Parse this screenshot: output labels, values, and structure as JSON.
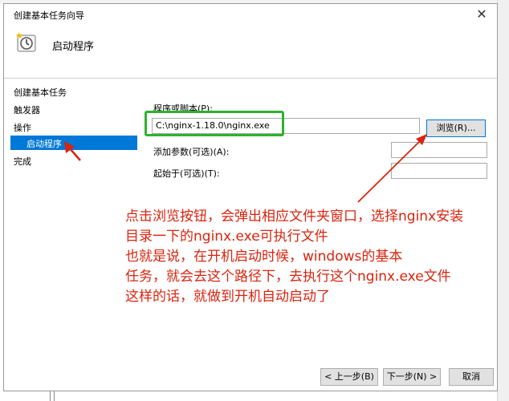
{
  "window": {
    "title": "创建基本任务向导",
    "close_glyph": "✕"
  },
  "header": {
    "title": "启动程序",
    "icon": "clock-task-icon"
  },
  "nav": {
    "items": [
      {
        "label": "创建基本任务"
      },
      {
        "label": "触发器"
      },
      {
        "label": "操作"
      },
      {
        "label": "启动程序"
      },
      {
        "label": "完成"
      }
    ],
    "selected_index": 3
  },
  "form": {
    "program_label": "程序或脚本(P):",
    "program_value": "C:\\nginx-1.18.0\\nginx.exe",
    "browse_label": "浏览(R)...",
    "args_label": "添加参数(可选)(A):",
    "args_value": "",
    "startin_label": "起始于(可选)(T):",
    "startin_value": ""
  },
  "footer": {
    "back_label": "< 上一步(B)",
    "next_label": "下一步(N) >",
    "cancel_label": "取消"
  },
  "annotation": {
    "lines": [
      "点击浏览按钮，会弹出相应文件夹窗口，选择nginx安装",
      "目录一下的nginx.exe可执行文件",
      "也就是说，在开机启动时候，windows的基本",
      "任务，就会去这个路径下，去执行这个nginx.exe文件",
      "这样的话，就做到开机自动启动了"
    ],
    "color": "#d9240f"
  },
  "colors": {
    "accent": "#0078d7",
    "highlight_box": "#2db22d",
    "arrow": "#d9240f"
  }
}
